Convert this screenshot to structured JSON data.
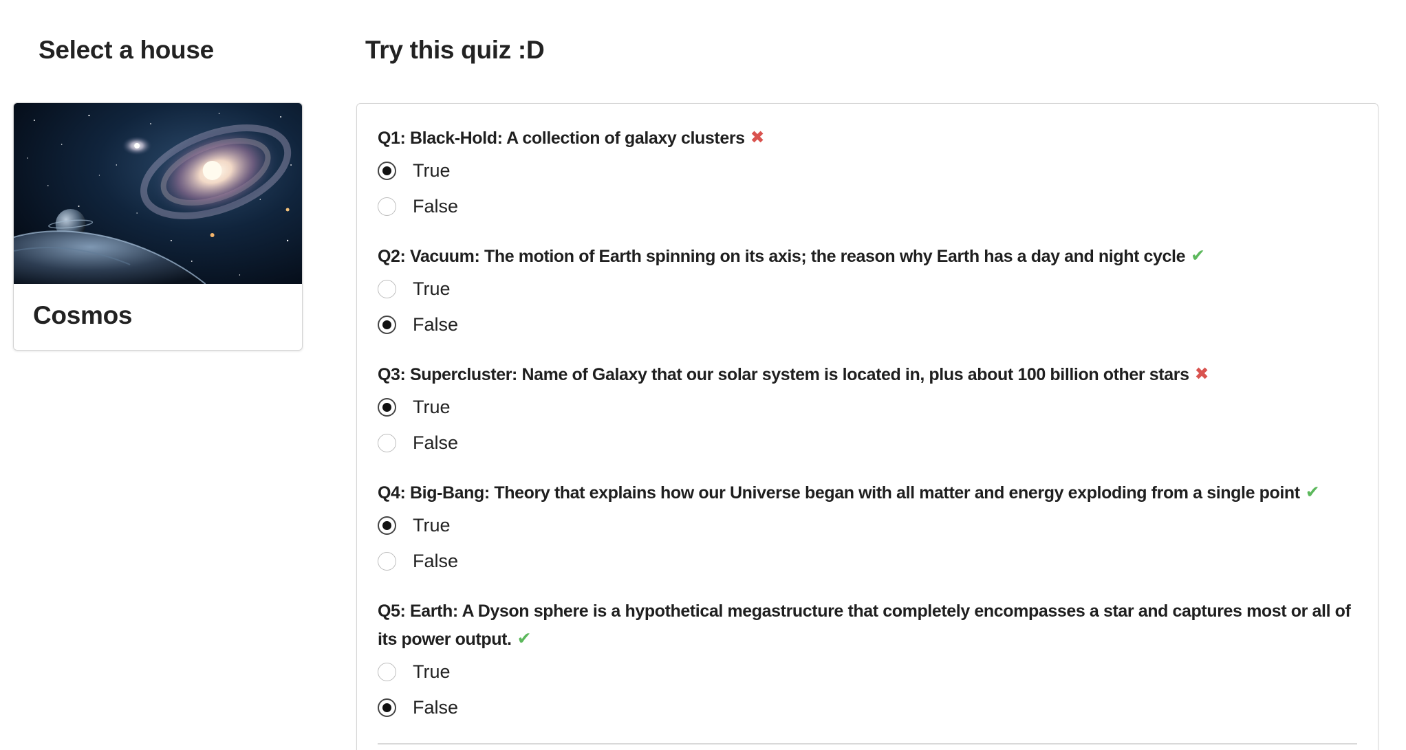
{
  "sidebar": {
    "title": "Select a house",
    "houses": [
      {
        "name": "Cosmos"
      }
    ]
  },
  "quiz": {
    "title": "Try this quiz :D",
    "questions": [
      {
        "text": "Q1: Black-Hold: A collection of galaxy clusters",
        "result": "wrong",
        "mark": "✖",
        "options": [
          {
            "label": "True",
            "selected": true
          },
          {
            "label": "False",
            "selected": false
          }
        ]
      },
      {
        "text": "Q2: Vacuum: The motion of Earth spinning on its axis; the reason why Earth has a day and night cycle",
        "result": "correct",
        "mark": "✔",
        "options": [
          {
            "label": "True",
            "selected": false
          },
          {
            "label": "False",
            "selected": true
          }
        ]
      },
      {
        "text": "Q3: Supercluster: Name of Galaxy that our solar system is located in, plus about 100 billion other stars",
        "result": "wrong",
        "mark": "✖",
        "options": [
          {
            "label": "True",
            "selected": true
          },
          {
            "label": "False",
            "selected": false
          }
        ]
      },
      {
        "text": "Q4: Big-Bang: Theory that explains how our Universe began with all matter and energy exploding from a single point",
        "result": "correct",
        "mark": "✔",
        "options": [
          {
            "label": "True",
            "selected": true
          },
          {
            "label": "False",
            "selected": false
          }
        ]
      },
      {
        "text": "Q5: Earth: A Dyson sphere is a hypothetical megastructure that completely encompasses a star and captures most or all of its power output.",
        "result": "correct",
        "mark": "✔",
        "options": [
          {
            "label": "True",
            "selected": false
          },
          {
            "label": "False",
            "selected": true
          }
        ]
      }
    ]
  },
  "colors": {
    "wrong": "#d9534f",
    "correct": "#5cb85c"
  }
}
